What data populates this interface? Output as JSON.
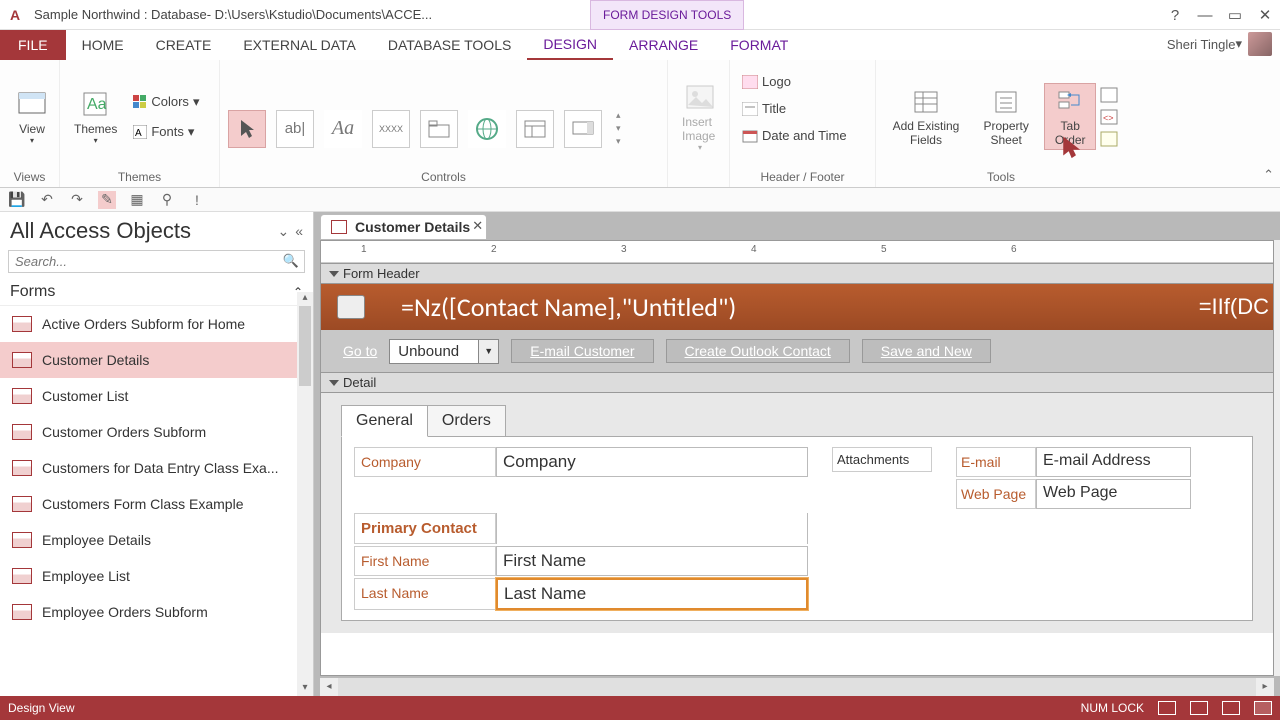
{
  "titlebar": {
    "app_title": "Sample Northwind : Database- D:\\Users\\Kstudio\\Documents\\ACCE...",
    "context_title": "FORM DESIGN TOOLS"
  },
  "tabs": {
    "file": "FILE",
    "home": "HOME",
    "create": "CREATE",
    "external": "EXTERNAL DATA",
    "dbtools": "DATABASE TOOLS",
    "design": "DESIGN",
    "arrange": "ARRANGE",
    "format": "FORMAT",
    "user": "Sheri Tingle"
  },
  "ribbon": {
    "views": {
      "label": "Views",
      "view": "View"
    },
    "themes": {
      "label": "Themes",
      "themes": "Themes",
      "colors": "Colors",
      "fonts": "Fonts"
    },
    "controls": {
      "label": "Controls"
    },
    "insertimage": "Insert Image",
    "headerfooter": {
      "label": "Header / Footer",
      "logo": "Logo",
      "title": "Title",
      "datetime": "Date and Time"
    },
    "tools": {
      "label": "Tools",
      "addfields": "Add Existing Fields",
      "propsheet": "Property Sheet",
      "taborder": "Tab Order"
    }
  },
  "nav": {
    "title": "All Access Objects",
    "search_placeholder": "Search...",
    "category": "Forms",
    "items": [
      "Active Orders Subform for Home",
      "Customer Details",
      "Customer List",
      "Customer Orders Subform",
      "Customers for Data Entry Class Exa...",
      "Customers Form Class Example",
      "Employee Details",
      "Employee List",
      "Employee Orders Subform"
    ],
    "active_index": 1
  },
  "doc_tab": "Customer Details",
  "ruler_marks": [
    "1",
    "2",
    "3",
    "4",
    "5",
    "6"
  ],
  "sections": {
    "header": "Form Header",
    "detail": "Detail"
  },
  "formheader": {
    "expr_main": "=Nz([Contact Name],\"Untitled\")",
    "expr_right": "=IIf(DC",
    "goto": "Go to",
    "combo": "Unbound",
    "btn_email": "E-mail Customer",
    "btn_outlook": "Create Outlook Contact",
    "btn_save": "Save and New"
  },
  "detail": {
    "tab_general": "General",
    "tab_orders": "Orders",
    "company_lbl": "Company",
    "company_val": "Company",
    "primary_lbl": "Primary Contact",
    "first_lbl": "First Name",
    "first_val": "First Name",
    "last_lbl": "Last Name",
    "last_val": "Last Name",
    "attach_lbl": "Attachments",
    "email_lbl": "E-mail",
    "email_val": "E-mail Address",
    "web_lbl": "Web Page",
    "web_val": "Web Page"
  },
  "status": {
    "left": "Design View",
    "numlock": "NUM LOCK"
  }
}
